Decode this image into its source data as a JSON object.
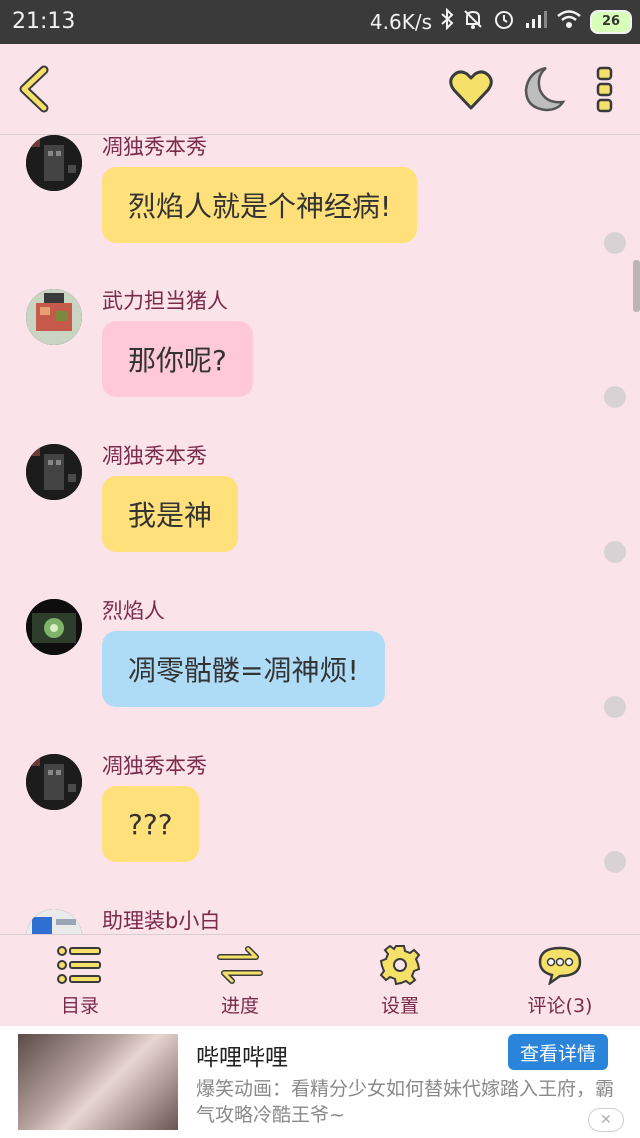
{
  "status_bar": {
    "time": "21:13",
    "network_speed": "4.6K/s",
    "battery": "26",
    "icons": [
      "bluetooth-icon",
      "mute-icon",
      "alarm-icon",
      "signal-icon",
      "wifi-icon",
      "battery-icon"
    ]
  },
  "header": {
    "icons": [
      "back-icon",
      "heart-icon",
      "moon-icon",
      "more-icon"
    ],
    "accent_color": "#f5e06a"
  },
  "messages": [
    {
      "sender": "凋独秀本秀",
      "text": "烈焰人就是个神经病!",
      "bubble_color": "#ffe07a"
    },
    {
      "sender": "武力担当猪人",
      "text": "那你呢?",
      "bubble_color": "#ffc9d8"
    },
    {
      "sender": "凋独秀本秀",
      "text": "我是神",
      "bubble_color": "#ffe07a"
    },
    {
      "sender": "烈焰人",
      "text": "凋零骷髅=凋神烦!",
      "bubble_color": "#aedcf7"
    },
    {
      "sender": "凋独秀本秀",
      "text": "???",
      "bubble_color": "#ffe07a"
    },
    {
      "sender": "助理装b小白",
      "text": ""
    }
  ],
  "toolbar": {
    "items": [
      {
        "label": "目录",
        "icon": "list-icon"
      },
      {
        "label": "进度",
        "icon": "swap-icon"
      },
      {
        "label": "设置",
        "icon": "gear-icon"
      },
      {
        "label": "评论(3)",
        "icon": "comment-icon"
      }
    ]
  },
  "ad": {
    "title": "哔哩哔哩",
    "button": "查看详情",
    "description": "爆笑动画：看精分少女如何替妹代嫁踏入王府，霸气攻略冷酷王爷~",
    "close": "✕"
  }
}
